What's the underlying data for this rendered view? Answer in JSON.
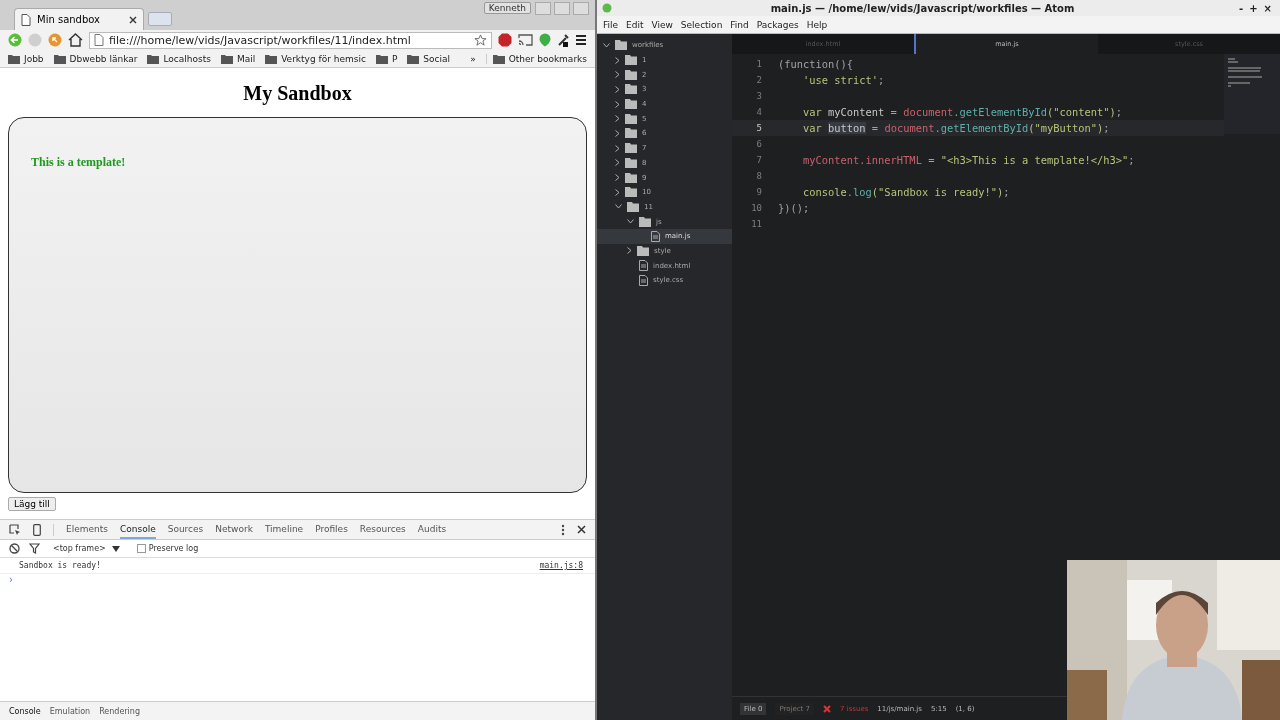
{
  "browser": {
    "tab_title": "Min sandbox",
    "user": "Kenneth",
    "address": "file:///home/lew/vids/Javascript/workfiles/11/index.html",
    "bookmarks": [
      "Jobb",
      "Dbwebb länkar",
      "Localhosts",
      "Mail",
      "Verktyg för hemsic",
      "P",
      "Social"
    ],
    "more": "»",
    "other_bookmarks": "Other bookmarks",
    "page": {
      "heading": "My Sandbox",
      "template_text": "This is a template!",
      "button": "Lägg till"
    },
    "devtools": {
      "tabs": [
        {
          "label": "Elements",
          "selected": false
        },
        {
          "label": "Console",
          "selected": true
        },
        {
          "label": "Sources",
          "selected": false
        },
        {
          "label": "Network",
          "selected": false
        },
        {
          "label": "Timeline",
          "selected": false
        },
        {
          "label": "Profiles",
          "selected": false
        },
        {
          "label": "Resources",
          "selected": false
        },
        {
          "label": "Audits",
          "selected": false
        }
      ],
      "frame": "<top frame>",
      "preserve_log": {
        "label": "Preserve log",
        "checked": false
      },
      "log": [
        {
          "message": "Sandbox is ready!",
          "source": "main.js:8"
        }
      ],
      "prompt": "›",
      "drawer_tabs": [
        {
          "label": "Console",
          "selected": true
        },
        {
          "label": "Emulation",
          "selected": false
        },
        {
          "label": "Rendering",
          "selected": false
        }
      ]
    }
  },
  "atom": {
    "title": "main.js — /home/lew/vids/Javascript/workfiles — Atom",
    "window_controls": [
      "-",
      "+",
      "×"
    ],
    "menu": [
      "File",
      "Edit",
      "View",
      "Selection",
      "Find",
      "Packages",
      "Help"
    ],
    "tree": {
      "name": "workfiles",
      "children": [
        {
          "name": "1",
          "kind": "folder",
          "expanded": false,
          "selected": false
        },
        {
          "name": "2",
          "kind": "folder",
          "expanded": false,
          "selected": false
        },
        {
          "name": "3",
          "kind": "folder",
          "expanded": false,
          "selected": false
        },
        {
          "name": "4",
          "kind": "folder",
          "expanded": false,
          "selected": false
        },
        {
          "name": "5",
          "kind": "folder",
          "expanded": false,
          "selected": false
        },
        {
          "name": "6",
          "kind": "folder",
          "expanded": false,
          "selected": false
        },
        {
          "name": "7",
          "kind": "folder",
          "expanded": false,
          "selected": false
        },
        {
          "name": "8",
          "kind": "folder",
          "expanded": false,
          "selected": false
        },
        {
          "name": "9",
          "kind": "folder",
          "expanded": false,
          "selected": false
        },
        {
          "name": "10",
          "kind": "folder",
          "expanded": false,
          "selected": false
        },
        {
          "name": "11",
          "kind": "folder",
          "expanded": true,
          "selected": false,
          "children": [
            {
              "name": "js",
              "kind": "folder",
              "expanded": true,
              "selected": false,
              "children": [
                {
                  "name": "main.js",
                  "kind": "file",
                  "selected": true
                }
              ]
            },
            {
              "name": "style",
              "kind": "folder",
              "expanded": false,
              "selected": false
            },
            {
              "name": "index.html",
              "kind": "file",
              "selected": false
            },
            {
              "name": "style.css",
              "kind": "file",
              "selected": false
            }
          ]
        }
      ]
    },
    "tabs": [
      {
        "label": "index.html",
        "selected": false
      },
      {
        "label": "main.js",
        "selected": true
      },
      {
        "label": "style.css",
        "selected": false
      }
    ],
    "lines": [
      {
        "number": "1",
        "current": false,
        "tokens": [
          {
            "kind": "punct",
            "text": "(function(){"
          }
        ]
      },
      {
        "number": "2",
        "current": false,
        "tokens": [
          {
            "kind": "str",
            "text": "    'use strict'"
          },
          {
            "kind": "punct",
            "text": ";"
          }
        ]
      },
      {
        "number": "3",
        "current": false
      },
      {
        "number": "4",
        "current": false,
        "tokens": [
          {
            "kind": "kw",
            "text": "    var "
          },
          {
            "kind": "ident",
            "text": "myContent "
          },
          {
            "kind": "punct",
            "text": "= "
          },
          {
            "kind": "obj",
            "text": "document"
          },
          {
            "kind": "fn",
            "text": ".getElementById"
          },
          {
            "kind": "str",
            "text": "(\"content\")"
          },
          {
            "kind": "punct",
            "text": ";"
          }
        ]
      },
      {
        "number": "5",
        "current": true,
        "tokens": [
          {
            "kind": "kw",
            "text": "    var "
          },
          {
            "kind": "marked",
            "text": "button"
          },
          {
            "kind": "punct",
            "text": " = "
          },
          {
            "kind": "obj",
            "text": "document"
          },
          {
            "kind": "fn",
            "text": ".getElementById"
          },
          {
            "kind": "str",
            "text": "(\"myButton\")"
          },
          {
            "kind": "punct",
            "text": ";"
          }
        ]
      },
      {
        "number": "6",
        "current": false
      },
      {
        "number": "7",
        "current": false,
        "tokens": [
          {
            "kind": "obj",
            "text": "    myContent.innerHTML "
          },
          {
            "kind": "punct",
            "text": "= "
          },
          {
            "kind": "str",
            "text": "\"<h3>This is a template!</h3>\""
          },
          {
            "kind": "punct",
            "text": ";"
          }
        ]
      },
      {
        "number": "8",
        "current": false
      },
      {
        "number": "9",
        "current": false,
        "tokens": [
          {
            "kind": "kw",
            "text": "    console"
          },
          {
            "kind": "fn",
            "text": ".log"
          },
          {
            "kind": "str",
            "text": "(\"Sandbox is ready!\")"
          },
          {
            "kind": "punct",
            "text": ";"
          }
        ]
      },
      {
        "number": "10",
        "current": false,
        "tokens": [
          {
            "kind": "punct",
            "text": "})();"
          }
        ]
      },
      {
        "number": "11",
        "current": false
      }
    ],
    "status": {
      "file_label": "File",
      "file_count": "0",
      "project_label": "Project",
      "project_count": "7",
      "issues": "7 issues",
      "path": "11/js/main.js",
      "cursor": "5:15",
      "selection": "(1, 6)"
    }
  }
}
